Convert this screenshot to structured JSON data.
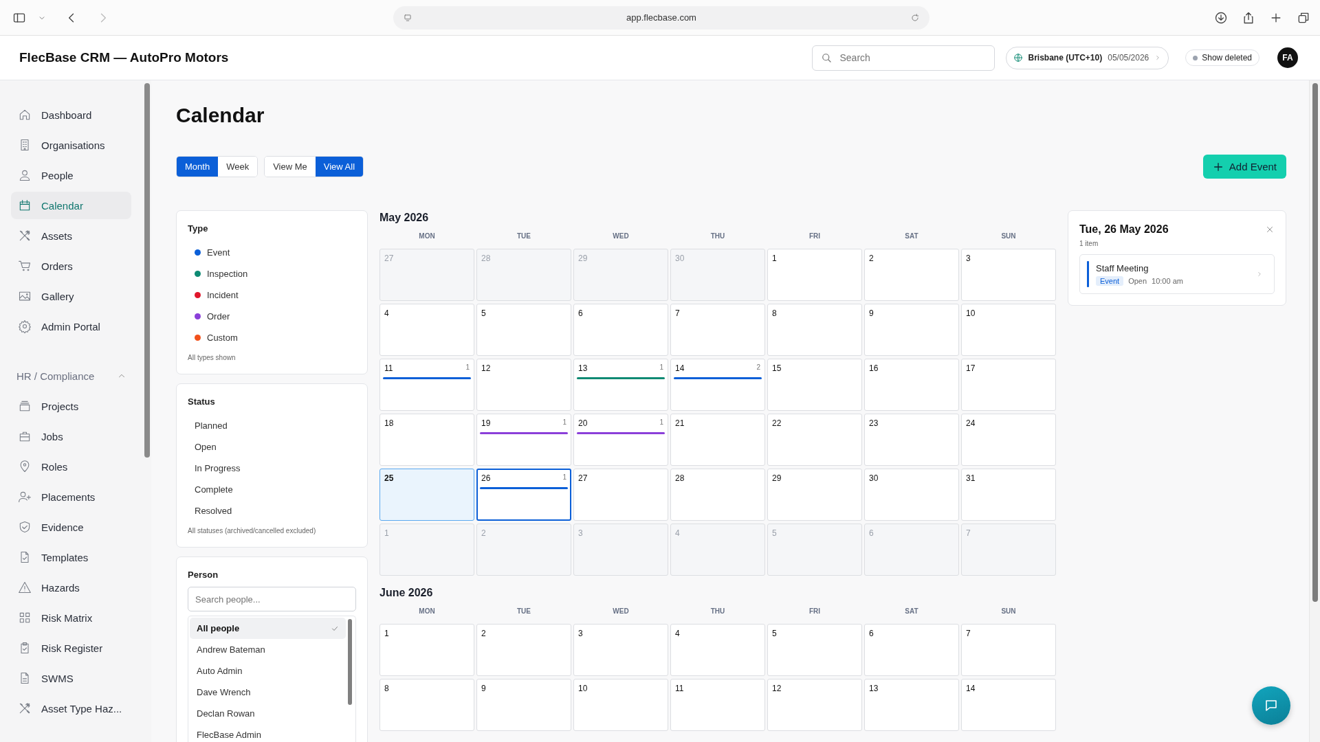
{
  "browser": {
    "url": "app.flecbase.com"
  },
  "header": {
    "title": "FlecBase CRM — AutoPro Motors",
    "search_placeholder": "Search",
    "timezone": "Brisbane (UTC+10)",
    "date": "05/05/2026",
    "show_deleted": {
      "label": "Show deleted",
      "on": false
    },
    "avatar": "FA"
  },
  "sidebar": {
    "items": [
      {
        "label": "Dashboard",
        "selected": false
      },
      {
        "label": "Organisations",
        "selected": false
      },
      {
        "label": "People",
        "selected": false
      },
      {
        "label": "Calendar",
        "selected": true
      },
      {
        "label": "Assets",
        "selected": false
      },
      {
        "label": "Orders",
        "selected": false
      },
      {
        "label": "Gallery",
        "selected": false
      },
      {
        "label": "Admin Portal",
        "selected": false
      }
    ],
    "section": {
      "label": "HR / Compliance",
      "expanded": true,
      "items": [
        {
          "label": "Projects",
          "selected": false
        },
        {
          "label": "Jobs",
          "selected": false
        },
        {
          "label": "Roles",
          "selected": false
        },
        {
          "label": "Placements",
          "selected": false
        },
        {
          "label": "Evidence",
          "selected": false
        },
        {
          "label": "Templates",
          "selected": false
        },
        {
          "label": "Hazards",
          "selected": false
        },
        {
          "label": "Risk Matrix",
          "selected": false
        },
        {
          "label": "Risk Register",
          "selected": false
        },
        {
          "label": "SWMS",
          "selected": false
        },
        {
          "label": "Asset Type Haz...",
          "selected": false
        }
      ]
    }
  },
  "page_title": "Calendar",
  "view_toggle": [
    {
      "label": "Month",
      "selected": true
    },
    {
      "label": "Week",
      "selected": false
    }
  ],
  "scope_toggle": [
    {
      "label": "View Me",
      "selected": false
    },
    {
      "label": "View All",
      "selected": true
    }
  ],
  "add_button": "Add Event",
  "filters": {
    "type": {
      "title": "Type",
      "items": [
        {
          "label": "Event",
          "color": "#0b5fd8"
        },
        {
          "label": "Inspection",
          "color": "#0e8a73"
        },
        {
          "label": "Incident",
          "color": "#e0162b"
        },
        {
          "label": "Order",
          "color": "#8b3fd9"
        },
        {
          "label": "Custom",
          "color": "#f2511b"
        }
      ],
      "note": "All types shown"
    },
    "status": {
      "title": "Status",
      "items": [
        "Planned",
        "Open",
        "In Progress",
        "Complete",
        "Resolved"
      ],
      "note": "All statuses (archived/cancelled excluded)"
    },
    "person": {
      "title": "Person",
      "placeholder": "Search people...",
      "items": [
        {
          "label": "All people",
          "selected": true
        },
        {
          "label": "Andrew Bateman",
          "selected": false
        },
        {
          "label": "Auto Admin",
          "selected": false
        },
        {
          "label": "Dave Wrench",
          "selected": false
        },
        {
          "label": "Declan Rowan",
          "selected": false
        },
        {
          "label": "FlecBase Admin",
          "selected": false
        }
      ]
    }
  },
  "months": [
    {
      "title": "May 2026",
      "weekdays": [
        "MON",
        "TUE",
        "WED",
        "THU",
        "FRI",
        "SAT",
        "SUN"
      ],
      "weeks": [
        [
          {
            "day": "27",
            "outside": true,
            "today": false,
            "selected": false
          },
          {
            "day": "28",
            "outside": true,
            "today": false,
            "selected": false
          },
          {
            "day": "29",
            "outside": true,
            "today": false,
            "selected": false
          },
          {
            "day": "30",
            "outside": true,
            "today": false,
            "selected": false
          },
          {
            "day": "1",
            "outside": false,
            "today": false,
            "selected": false
          },
          {
            "day": "2",
            "outside": false,
            "today": false,
            "selected": false
          },
          {
            "day": "3",
            "outside": false,
            "today": false,
            "selected": false
          }
        ],
        [
          {
            "day": "4",
            "outside": false,
            "today": false,
            "selected": false
          },
          {
            "day": "5",
            "outside": false,
            "today": false,
            "selected": false
          },
          {
            "day": "6",
            "outside": false,
            "today": false,
            "selected": false
          },
          {
            "day": "7",
            "outside": false,
            "today": false,
            "selected": false
          },
          {
            "day": "8",
            "outside": false,
            "today": false,
            "selected": false
          },
          {
            "day": "9",
            "outside": false,
            "today": false,
            "selected": false
          },
          {
            "day": "10",
            "outside": false,
            "today": false,
            "selected": false
          }
        ],
        [
          {
            "day": "11",
            "outside": false,
            "today": false,
            "selected": false,
            "count": "1",
            "color": "#0b5fd8"
          },
          {
            "day": "12",
            "outside": false,
            "today": false,
            "selected": false
          },
          {
            "day": "13",
            "outside": false,
            "today": false,
            "selected": false,
            "count": "1",
            "color": "#0e8a73"
          },
          {
            "day": "14",
            "outside": false,
            "today": false,
            "selected": false,
            "count": "2",
            "color": "#0b5fd8"
          },
          {
            "day": "15",
            "outside": false,
            "today": false,
            "selected": false
          },
          {
            "day": "16",
            "outside": false,
            "today": false,
            "selected": false
          },
          {
            "day": "17",
            "outside": false,
            "today": false,
            "selected": false
          }
        ],
        [
          {
            "day": "18",
            "outside": false,
            "today": false,
            "selected": false
          },
          {
            "day": "19",
            "outside": false,
            "today": false,
            "selected": false,
            "count": "1",
            "color": "#8b3fd9"
          },
          {
            "day": "20",
            "outside": false,
            "today": false,
            "selected": false,
            "count": "1",
            "color": "#8b3fd9"
          },
          {
            "day": "21",
            "outside": false,
            "today": false,
            "selected": false
          },
          {
            "day": "22",
            "outside": false,
            "today": false,
            "selected": false
          },
          {
            "day": "23",
            "outside": false,
            "today": false,
            "selected": false
          },
          {
            "day": "24",
            "outside": false,
            "today": false,
            "selected": false
          }
        ],
        [
          {
            "day": "25",
            "outside": false,
            "today": true,
            "selected": false
          },
          {
            "day": "26",
            "outside": false,
            "today": false,
            "selected": true,
            "count": "1",
            "color": "#0b5fd8"
          },
          {
            "day": "27",
            "outside": false,
            "today": false,
            "selected": false
          },
          {
            "day": "28",
            "outside": false,
            "today": false,
            "selected": false
          },
          {
            "day": "29",
            "outside": false,
            "today": false,
            "selected": false
          },
          {
            "day": "30",
            "outside": false,
            "today": false,
            "selected": false
          },
          {
            "day": "31",
            "outside": false,
            "today": false,
            "selected": false
          }
        ],
        [
          {
            "day": "1",
            "outside": true,
            "today": false,
            "selected": false
          },
          {
            "day": "2",
            "outside": true,
            "today": false,
            "selected": false
          },
          {
            "day": "3",
            "outside": true,
            "today": false,
            "selected": false
          },
          {
            "day": "4",
            "outside": true,
            "today": false,
            "selected": false
          },
          {
            "day": "5",
            "outside": true,
            "today": false,
            "selected": false
          },
          {
            "day": "6",
            "outside": true,
            "today": false,
            "selected": false
          },
          {
            "day": "7",
            "outside": true,
            "today": false,
            "selected": false
          }
        ]
      ]
    },
    {
      "title": "June 2026",
      "weekdays": [
        "MON",
        "TUE",
        "WED",
        "THU",
        "FRI",
        "SAT",
        "SUN"
      ],
      "weeks": [
        [
          {
            "day": "1",
            "outside": false,
            "today": false,
            "selected": false
          },
          {
            "day": "2",
            "outside": false,
            "today": false,
            "selected": false
          },
          {
            "day": "3",
            "outside": false,
            "today": false,
            "selected": false
          },
          {
            "day": "4",
            "outside": false,
            "today": false,
            "selected": false
          },
          {
            "day": "5",
            "outside": false,
            "today": false,
            "selected": false
          },
          {
            "day": "6",
            "outside": false,
            "today": false,
            "selected": false
          },
          {
            "day": "7",
            "outside": false,
            "today": false,
            "selected": false
          }
        ],
        [
          {
            "day": "8",
            "outside": false,
            "today": false,
            "selected": false
          },
          {
            "day": "9",
            "outside": false,
            "today": false,
            "selected": false
          },
          {
            "day": "10",
            "outside": false,
            "today": false,
            "selected": false
          },
          {
            "day": "11",
            "outside": false,
            "today": false,
            "selected": false
          },
          {
            "day": "12",
            "outside": false,
            "today": false,
            "selected": false
          },
          {
            "day": "13",
            "outside": false,
            "today": false,
            "selected": false
          },
          {
            "day": "14",
            "outside": false,
            "today": false,
            "selected": false
          }
        ]
      ]
    }
  ],
  "day_panel": {
    "title": "Tue, 26 May 2026",
    "count": "1 item",
    "items": [
      {
        "title": "Staff Meeting",
        "type": "Event",
        "status": "Open",
        "time": "10:00 am",
        "color": "#0b5fd8"
      }
    ]
  }
}
